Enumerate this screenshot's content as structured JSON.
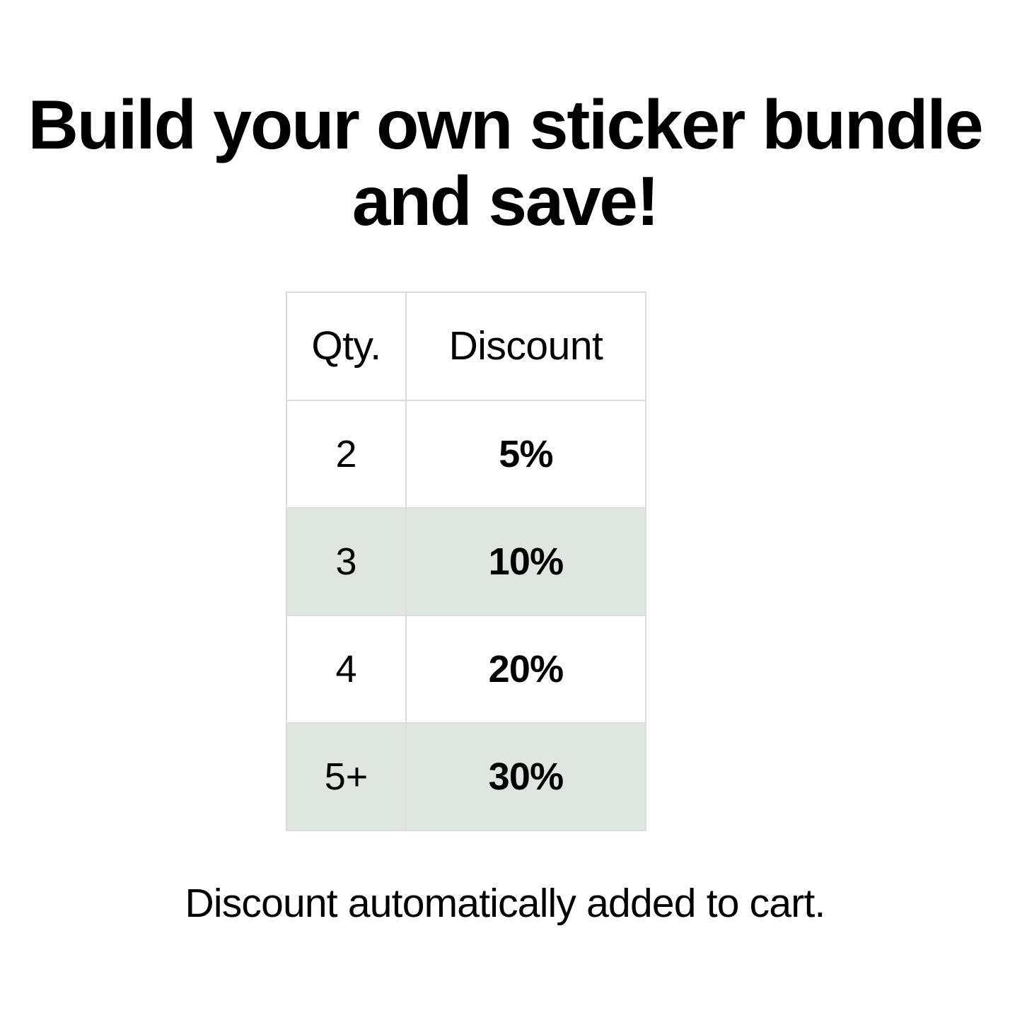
{
  "colors": {
    "background": "#ffffff",
    "text": "#000000",
    "table_border": "#dcdcdc",
    "row_tint": "#dfe5df"
  },
  "heading": {
    "line_1": "Build your own sticker bundle",
    "line_2": "and save!",
    "full": "Build your own sticker bundle and save!"
  },
  "table": {
    "headers": [
      "Qty.",
      "Discount"
    ],
    "rows": [
      {
        "qty": "2",
        "discount": "5%",
        "tinted": false
      },
      {
        "qty": "3",
        "discount": "10%",
        "tinted": true
      },
      {
        "qty": "4",
        "discount": "20%",
        "tinted": false
      },
      {
        "qty": "5+",
        "discount": "30%",
        "tinted": true
      }
    ]
  },
  "footnote": {
    "text": "Discount automatically added to cart."
  }
}
